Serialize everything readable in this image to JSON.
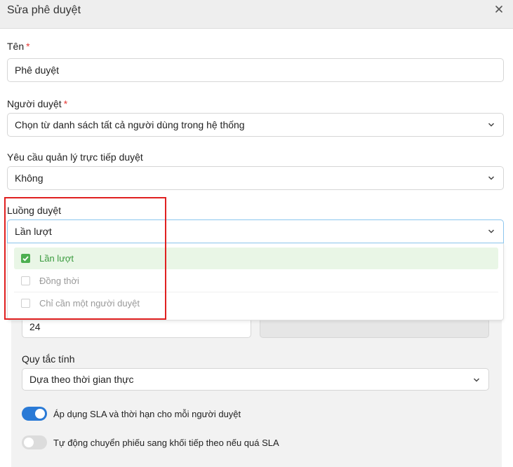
{
  "dialog": {
    "title": "Sửa phê duyệt"
  },
  "name": {
    "label": "Tên",
    "required": "*",
    "value": "Phê duyệt"
  },
  "approver": {
    "label": "Người duyệt",
    "required": "*",
    "value": "Chọn từ danh sách tất cả người dùng trong hệ thống"
  },
  "manager_approval": {
    "label": "Yêu cầu quản lý trực tiếp duyệt",
    "value": "Không"
  },
  "flow": {
    "label": "Luồng duyệt",
    "value": "Lần lượt",
    "options": [
      {
        "label": "Lần lượt",
        "checked": true
      },
      {
        "label": "Đồng thời",
        "checked": false
      },
      {
        "label": "Chỉ cần một người duyệt",
        "checked": false
      }
    ]
  },
  "sla": {
    "duration_value": "24",
    "rule_label": "Quy tắc tính",
    "rule_value": "Dựa theo thời gian thực",
    "per_approver_toggle": {
      "label": "Áp dụng SLA và thời hạn cho mỗi người duyệt",
      "on": true
    },
    "auto_forward_toggle": {
      "label": "Tự động chuyển phiếu sang khối tiếp theo nếu quá SLA",
      "on": false
    }
  },
  "colors": {
    "accent": "#2a7ad6",
    "selected_option": "#4caf50",
    "highlight": "#e02020",
    "required": "#e53935"
  }
}
